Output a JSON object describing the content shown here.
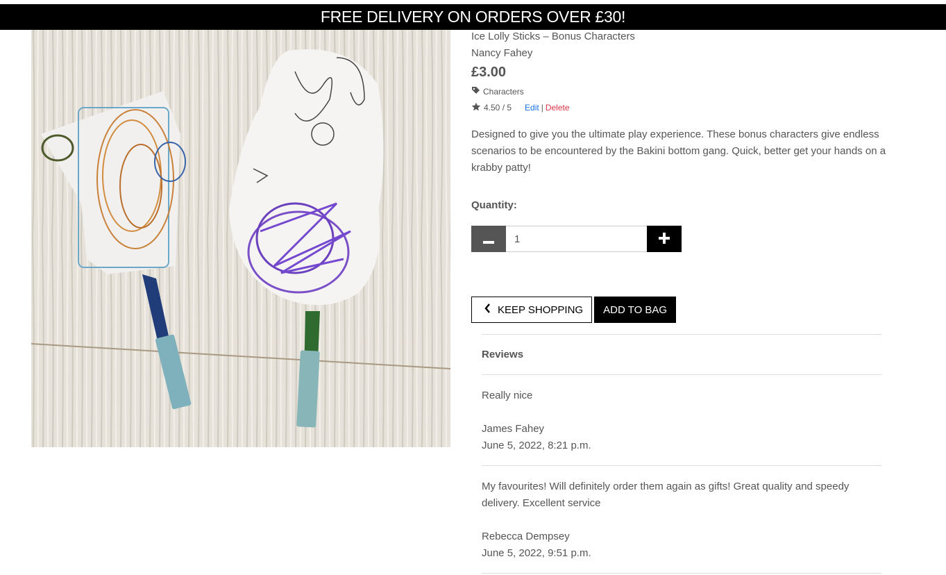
{
  "banner": {
    "text": "FREE DELIVERY ON ORDERS OVER £30!"
  },
  "product": {
    "title": "Ice Lolly Sticks – Bonus Characters",
    "maker": "Nancy Fahey",
    "price": "£3.00",
    "category": "Characters",
    "category_icon": "tag-icon",
    "rating": "4.50 / 5",
    "rating_icon": "star-icon",
    "edit_label": "Edit",
    "separator": "|",
    "delete_label": "Delete",
    "description": "Designed to give you the ultimate play experience. These bonus characters give endless scenarios to be encountered by the Bakini bottom gang. Quick, better get your hands on a krabby patty!"
  },
  "quantity": {
    "label": "Quantity:",
    "value": "1",
    "minus_icon": "minus-icon",
    "plus_icon": "plus-icon"
  },
  "actions": {
    "keep_shopping": "KEEP SHOPPING",
    "add_to_bag": "ADD TO BAG"
  },
  "reviews": {
    "heading": "Reviews",
    "items": [
      {
        "body": "Really nice",
        "author": "James Fahey",
        "date": "June 5, 2022, 8:21 p.m."
      },
      {
        "body": "My favourites! Will definitely order them again as gifts! Great quality and speedy delivery. Excellent service",
        "author": "Rebecca Dempsey",
        "date": "June 5, 2022, 9:51 p.m."
      }
    ]
  },
  "colors": {
    "banner_bg": "#000000",
    "edit_link": "#1a73e8",
    "delete_link": "#dc3545",
    "minus_button": "#555555",
    "plus_button": "#000000"
  }
}
